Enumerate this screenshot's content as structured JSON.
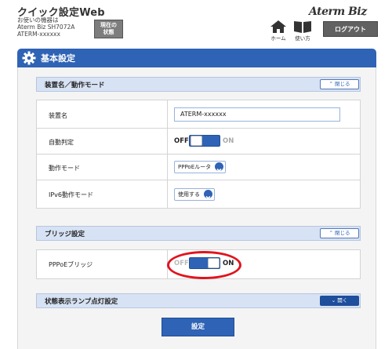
{
  "header": {
    "title": "クイック設定Web",
    "device_lines": [
      "お使いの機器は",
      "Aterm Biz SH7072A",
      "ATERM-xxxxxx"
    ],
    "status_button": [
      "現在の",
      "状態"
    ],
    "brand": "Aterm Biz",
    "home_label": "ホーム",
    "help_label": "使い方",
    "logout_label": "ログアウト"
  },
  "page": {
    "heading": "基本設定"
  },
  "sections": {
    "device": {
      "title": "装置名／動作モード",
      "toggle_label": "閉じる",
      "rows": {
        "device_name": {
          "label": "装置名",
          "value": "ATERM-xxxxxx"
        },
        "auto_detect": {
          "label": "自動判定",
          "off": "OFF",
          "on": "ON",
          "state": "ON"
        },
        "mode": {
          "label": "動作モード",
          "value": "PPPoEルータ"
        },
        "ipv6": {
          "label": "IPv6動作モード",
          "value": "使用する"
        }
      }
    },
    "bridge": {
      "title": "ブリッジ設定",
      "toggle_label": "閉じる",
      "rows": {
        "pppoe_bridge": {
          "label": "PPPoEブリッジ",
          "off": "OFF",
          "on": "ON",
          "state": "ON"
        }
      }
    },
    "lamp": {
      "title": "状態表示ランプ点灯設定",
      "toggle_label": "開く"
    }
  },
  "actions": {
    "apply_label": "設定"
  },
  "colors": {
    "accent": "#2f63b5",
    "section_bar": "#d7e2f4",
    "highlight": "#e0141e"
  }
}
